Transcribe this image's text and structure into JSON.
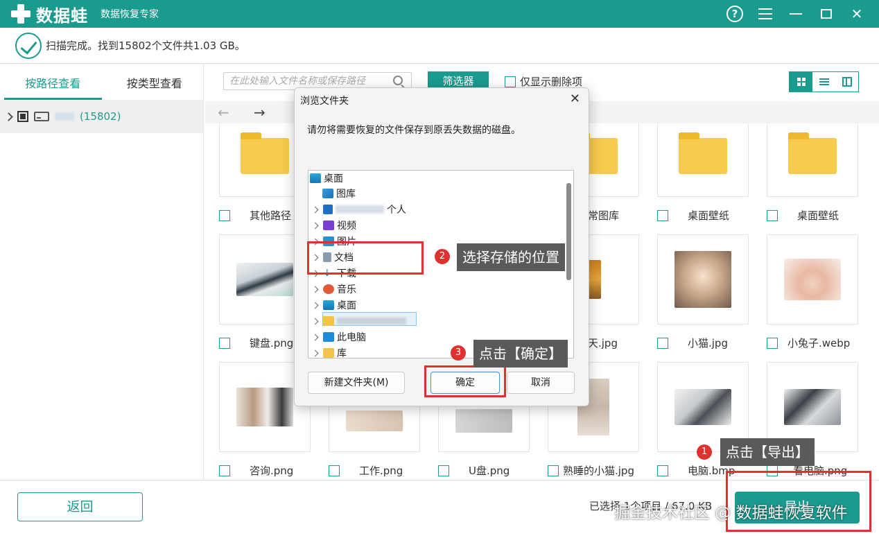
{
  "app": {
    "logo_text": "数据蛙",
    "subtitle": "数据恢复专家",
    "help_icon": "help-icon",
    "menu_icon": "menu-icon"
  },
  "status": {
    "text": "扫描完成。找到15802个文件共1.03 GB。"
  },
  "left_panel": {
    "tabs": [
      {
        "label": "按路径查看",
        "active": true
      },
      {
        "label": "按类型查看",
        "active": false
      }
    ],
    "tree_count": "(15802)"
  },
  "toolbar": {
    "search_placeholder": "在此处输入文件名称或保存路径",
    "filter_label": "筛选器",
    "only_deleted_label": "仅显示删除项"
  },
  "files": {
    "row1": [
      {
        "name": "其他路径"
      },
      {
        "name": "常图库"
      },
      {
        "name": "桌面壁纸"
      },
      {
        "name": "桌面壁纸"
      }
    ],
    "row2": [
      {
        "name": "键盘.png"
      },
      {
        "name": "天.jpg"
      },
      {
        "name": "小猫.jpg"
      },
      {
        "name": "小兔子.webp"
      }
    ],
    "row3": [
      {
        "name": "咨询.png"
      },
      {
        "name": "工作.png"
      },
      {
        "name": "U盘.png"
      },
      {
        "name": "熟睡的小猫.jpg"
      },
      {
        "name": "电脑.bmp"
      },
      {
        "name": "看电脑.png"
      }
    ]
  },
  "bottom": {
    "back_label": "返回",
    "selected_info": "已选择 1个项目 / 67.0 KB",
    "export_label": "导出"
  },
  "dialog": {
    "title": "浏览文件夹",
    "message": "请勿将需要恢复的文件保存到原丢失数据的磁盘。",
    "tree": [
      {
        "label": "桌面",
        "icon": "desktop-icon"
      },
      {
        "label": "图库",
        "icon": "gallery-icon"
      },
      {
        "label": "个人",
        "icon": "cloud-icon"
      },
      {
        "label": "视频",
        "icon": "video-icon"
      },
      {
        "label": "图片",
        "icon": "pictures-icon"
      },
      {
        "label": "文档",
        "icon": "document-icon"
      },
      {
        "label": "下载",
        "icon": "download-icon"
      },
      {
        "label": "音乐",
        "icon": "music-icon"
      },
      {
        "label": "桌面",
        "icon": "desktop-icon"
      },
      {
        "label": "",
        "icon": "folder-icon"
      },
      {
        "label": "此电脑",
        "icon": "computer-icon"
      },
      {
        "label": "库",
        "icon": "library-icon"
      }
    ],
    "new_folder_label": "新建文件夹(M)",
    "ok_label": "确定",
    "cancel_label": "取消"
  },
  "annotations": {
    "step1": {
      "num": "1",
      "text": "点击【导出】"
    },
    "step2": {
      "num": "2",
      "text": "选择存储的位置"
    },
    "step3": {
      "num": "3",
      "text": "点击【确定】"
    },
    "highlight_color": "#e03131"
  },
  "watermark": "掘金技术社区 @ 数据蛙恢复软件",
  "colors": {
    "accent": "#1a9b8e",
    "folder": "#f7cb4d"
  }
}
